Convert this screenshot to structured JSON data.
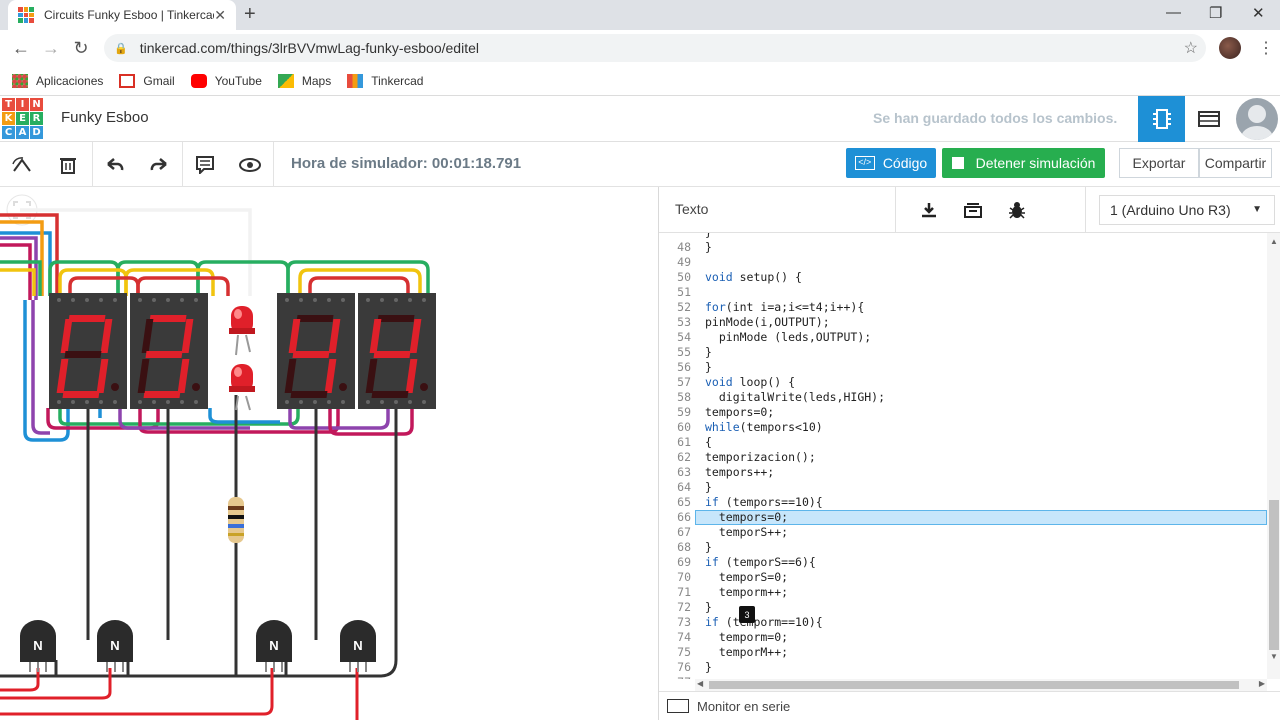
{
  "browser": {
    "tab_title": "Circuits Funky Esboo | Tinkercad",
    "url": "tinkercad.com/things/3lrBVVmwLag-funky-esboo/editel",
    "bookmarks": [
      "Aplicaciones",
      "Gmail",
      "YouTube",
      "Maps",
      "Tinkercad"
    ]
  },
  "header": {
    "logo_letters": [
      "T",
      "I",
      "N",
      "K",
      "E",
      "R",
      "C",
      "A",
      "D"
    ],
    "project_name": "Funky Esboo",
    "save_status": "Se han guardado todos los cambios."
  },
  "toolbar": {
    "sim_time": "Hora de simulador: 00:01:18.791",
    "code_label": "Código",
    "stop_label": "Detener simulación",
    "export_label": "Exportar",
    "share_label": "Compartir"
  },
  "codepanel": {
    "mode": "Texto",
    "board": "1 (Arduino Uno R3)",
    "serial_monitor": "Monitor en serie",
    "cursor_badge": "3",
    "highlighted_line": 66,
    "lines": [
      {
        "n": "",
        "t": "}"
      },
      {
        "n": "48",
        "t": "}"
      },
      {
        "n": "49",
        "t": ""
      },
      {
        "n": "50",
        "t": "void setup() {"
      },
      {
        "n": "51",
        "t": ""
      },
      {
        "n": "52",
        "t": "for(int i=a;i<=t4;i++){"
      },
      {
        "n": "53",
        "t": "pinMode(i,OUTPUT);"
      },
      {
        "n": "54",
        "t": "  pinMode (leds,OUTPUT);"
      },
      {
        "n": "55",
        "t": "}"
      },
      {
        "n": "56",
        "t": "}"
      },
      {
        "n": "57",
        "t": "void loop() {"
      },
      {
        "n": "58",
        "t": "  digitalWrite(leds,HIGH);"
      },
      {
        "n": "59",
        "t": "tempors=0;"
      },
      {
        "n": "60",
        "t": "while(tempors<10)"
      },
      {
        "n": "61",
        "t": "{"
      },
      {
        "n": "62",
        "t": "temporizacion();"
      },
      {
        "n": "63",
        "t": "tempors++;"
      },
      {
        "n": "64",
        "t": "}"
      },
      {
        "n": "65",
        "t": "if (tempors==10){"
      },
      {
        "n": "66",
        "t": "  tempors=0;"
      },
      {
        "n": "67",
        "t": "  temporS++;"
      },
      {
        "n": "68",
        "t": "}"
      },
      {
        "n": "69",
        "t": "if (temporS==6){"
      },
      {
        "n": "70",
        "t": "  temporS=0;"
      },
      {
        "n": "71",
        "t": "  temporm++;"
      },
      {
        "n": "72",
        "t": "}"
      },
      {
        "n": "73",
        "t": "if (temporm==10){"
      },
      {
        "n": "74",
        "t": "  temporm=0;"
      },
      {
        "n": "75",
        "t": "  temporM++;"
      },
      {
        "n": "76",
        "t": "}"
      },
      {
        "n": "77",
        "t": ""
      }
    ]
  },
  "circuit": {
    "display_digits": [
      "0",
      "3",
      "4",
      "4"
    ],
    "transistor_label": "N",
    "segment_color": "#e0202a",
    "segment_off_color": "#3a1012"
  },
  "colors": {
    "accent_blue": "#1e90d6",
    "stop_green": "#27ae4f"
  }
}
